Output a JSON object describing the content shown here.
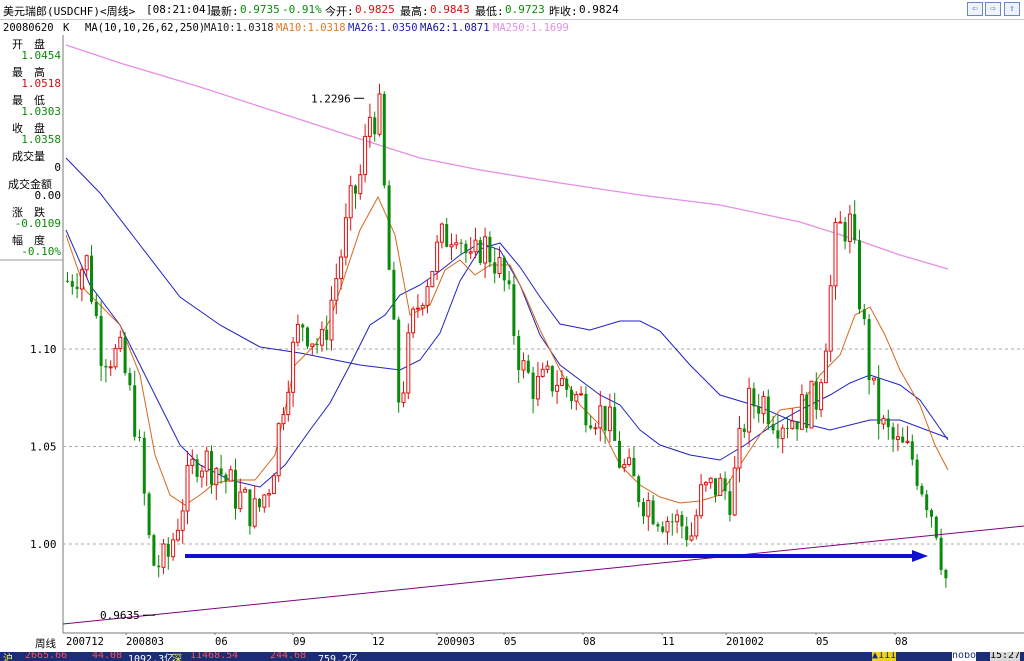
{
  "header": {
    "title": "美元瑞郎(USDCHF)<周线>",
    "time": "[08:21:04]",
    "latest_label": "最新:",
    "latest_value": "0.9735",
    "change_pct": "-0.91%",
    "open_label": "今开:",
    "open_value": "0.9825",
    "high_label": "最高:",
    "high_value": "0.9843",
    "low_label": "最低:",
    "low_value": "0.9723",
    "prevclose_label": "昨收:",
    "prevclose_value": "0.9824",
    "buttons": [
      "⇦",
      "⇨",
      "⇧"
    ]
  },
  "ma_bar": {
    "date": "20080620",
    "period": "K",
    "ma_params": "MA(10,10,26,62,250)",
    "ma10a": "MA10:1.0318",
    "ma10b": "MA10:1.0318",
    "ma26": "MA26:1.0350",
    "ma62": "MA62:1.0871",
    "ma250": "MA250:1.1699"
  },
  "info": [
    {
      "label": "开　盘",
      "value": "1.0454"
    },
    {
      "label": "最　高",
      "value": "1.0518"
    },
    {
      "label": "最　低",
      "value": "1.0303"
    },
    {
      "label": "收　盘",
      "value": "1.0358"
    },
    {
      "label": "成交量",
      "value": "0"
    },
    {
      "label": "成交金额",
      "value": "0.00"
    },
    {
      "label": "涨　跌",
      "value": "-0.0109"
    },
    {
      "label": "幅　度",
      "value": "-0.10%"
    }
  ],
  "chart_data": {
    "type": "candlestick",
    "y_ticks": [
      "1.10",
      "1.05",
      "1.00"
    ],
    "y_tick_values": [
      1.1,
      1.05,
      1.0
    ],
    "ylim": [
      0.955,
      1.295
    ],
    "x_ticks": [
      "周线",
      "200712",
      "200803",
      "06",
      "09",
      "12",
      "200903",
      "05",
      "08",
      "11",
      "201002",
      "05",
      "08"
    ],
    "annotations": [
      {
        "text": "1.2296",
        "value": 1.2296
      },
      {
        "text": "0.9635",
        "value": 0.9635
      }
    ],
    "colors": {
      "up": "#e01010",
      "down": "#0a8a0a",
      "ma10": "#d2691e",
      "ma26": "#2020c0",
      "ma250": "#e58fe5",
      "arrow": "#1010d0",
      "trendline": "#800080"
    }
  },
  "status_bar": [
    "沪",
    "2665.66",
    "44.08",
    "1092.3亿",
    "深",
    "11468.54",
    "244.68",
    "759.2亿",
    "▲111",
    "nobo",
    "15:27"
  ]
}
